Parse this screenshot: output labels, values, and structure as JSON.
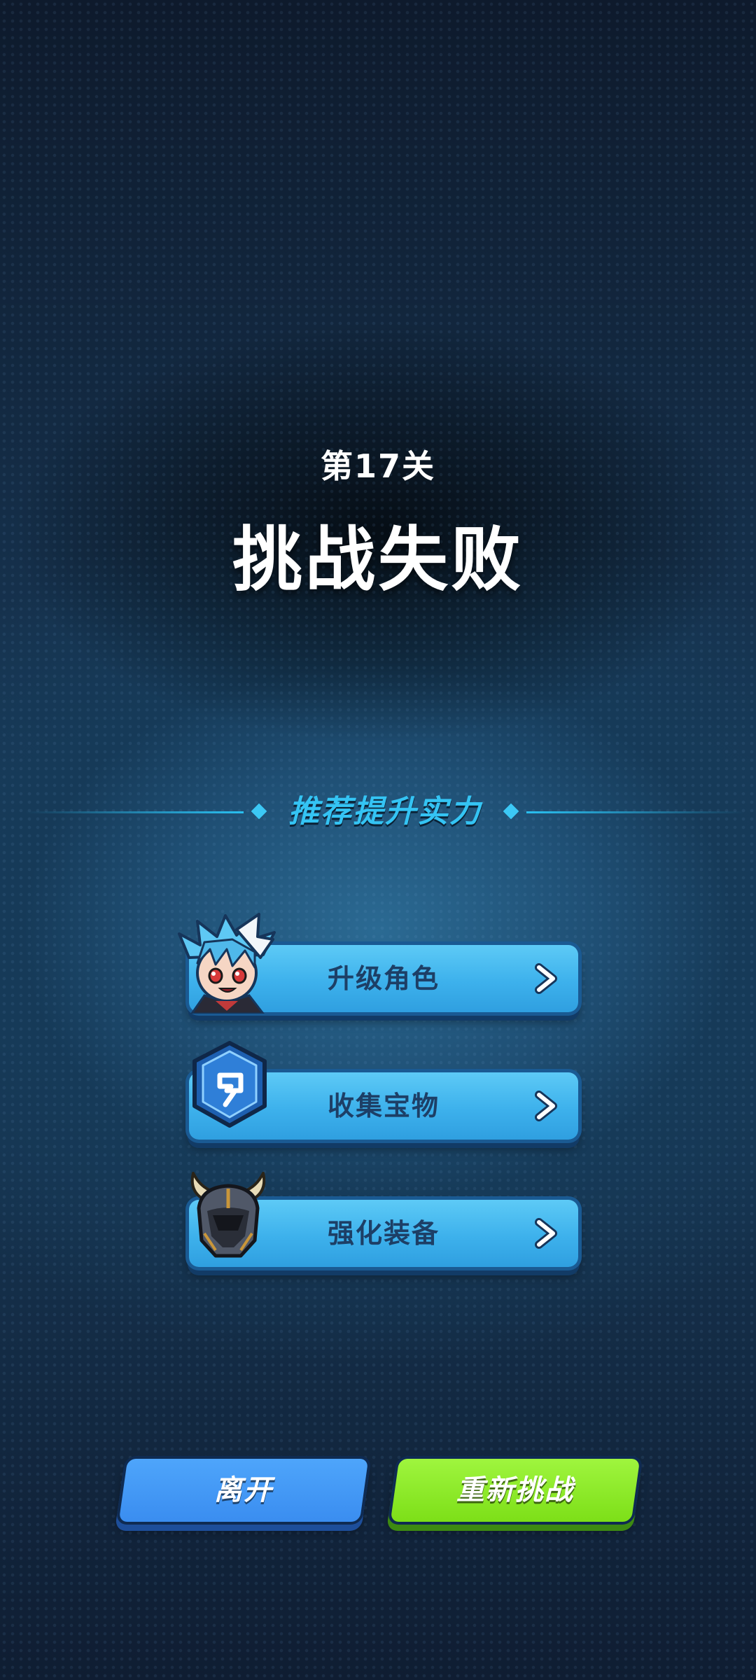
{
  "stage": {
    "label": "第17关",
    "result": "挑战失败"
  },
  "recommend": {
    "title": "推荐提升实力",
    "items": [
      {
        "label": "升级角色",
        "icon": "character-portrait-icon"
      },
      {
        "label": "收集宝物",
        "icon": "treasure-gem-icon"
      },
      {
        "label": "强化装备",
        "icon": "horned-helmet-icon"
      }
    ]
  },
  "actions": {
    "leave_label": "离开",
    "retry_label": "重新挑战"
  },
  "colors": {
    "accent_cyan": "#34c4f4",
    "panel_blue": "#3db1ec",
    "leave_blue": "#3a8df0",
    "retry_green": "#7ddf18"
  }
}
